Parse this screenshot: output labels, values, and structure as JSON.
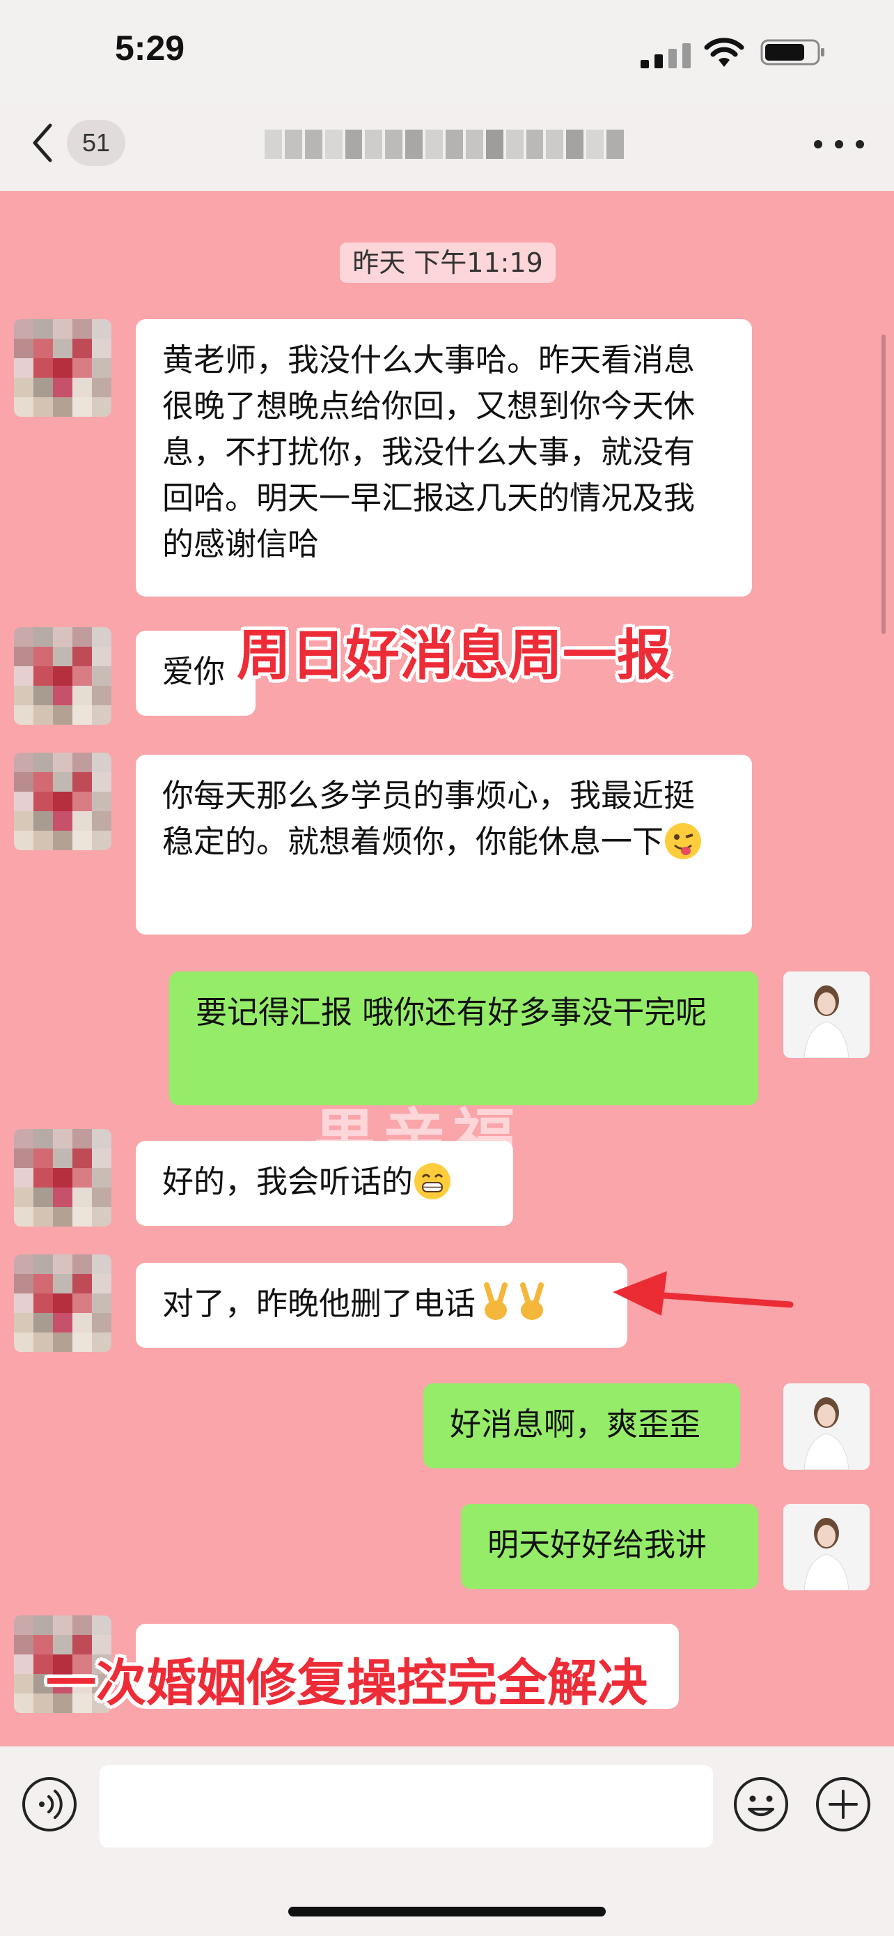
{
  "status_bar": {
    "time": "5:29"
  },
  "nav": {
    "back_count": "51",
    "more_icon": "more-icon"
  },
  "chat": {
    "timestamp": "昨天 下午11:19",
    "watermark": "果亲福",
    "messages": [
      {
        "side": "left",
        "text": "黄老师，我没什么大事哈。昨天看消息很晚了想晚点给你回，又想到你今天休息，不打扰你，我没什么大事，就没有回哈。明天一早汇报这几天的情况及我的感谢信哈"
      },
      {
        "side": "left",
        "text": "爱你"
      },
      {
        "side": "left",
        "text": "你每天那么多学员的事烦心，我最近挺稳定的。就想着烦你，你能休息一下",
        "emoji": "wink-tongue-emoji"
      },
      {
        "side": "right",
        "text": "要记得汇报 哦你还有好多事没干完呢"
      },
      {
        "side": "left",
        "text": "好的，我会听话的",
        "emoji": "grin-emoji"
      },
      {
        "side": "left",
        "text": "对了，昨晚他删了电话",
        "emoji": "victory-hand-emoji"
      },
      {
        "side": "right",
        "text": "好消息啊，爽歪歪"
      },
      {
        "side": "right",
        "text": "明天好好给我讲"
      }
    ]
  },
  "overlays": {
    "top_caption": "周日好消息周一报",
    "bottom_caption": "一次婚姻修复操控完全解决"
  },
  "colors": {
    "chat_bg": "#f9a5aa",
    "my_bubble": "#95ec69",
    "their_bubble": "#ffffff",
    "caption_red": "#ee2c37"
  }
}
